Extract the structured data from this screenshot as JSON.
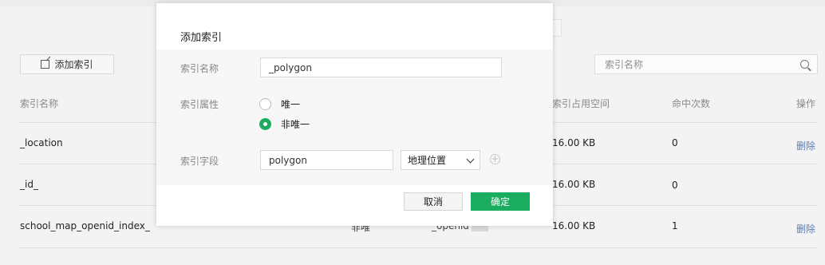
{
  "toolbar": {
    "add_index_label": "添加索引"
  },
  "search": {
    "placeholder": "索引名称"
  },
  "table": {
    "headers": {
      "name": "索引名称",
      "space": "索引占用空间",
      "hits": "命中次数",
      "action": "操作"
    },
    "rows": [
      {
        "name": "_location",
        "space": "16.00 KB",
        "hits": "0",
        "action": "删除"
      },
      {
        "name": "_id_",
        "space": "16.00 KB",
        "hits": "0",
        "action": ""
      },
      {
        "name": "school_map_openid_index_",
        "space": "16.00 KB",
        "hits": "1",
        "action": "删除",
        "partial_type": "非唯",
        "partial_field": "_openid"
      }
    ]
  },
  "modal": {
    "title": "添加索引",
    "name_label": "索引名称",
    "name_value": "_polygon",
    "attr_label": "索引属性",
    "radio_unique": "唯一",
    "radio_non_unique": "非唯一",
    "radio_selected": "非唯一",
    "field_label": "索引字段",
    "field_value": "polygon",
    "field_type": "地理位置",
    "cancel_label": "取消",
    "confirm_label": "确定"
  },
  "colors": {
    "accent": "#1aad5f",
    "link": "#5b7db8"
  },
  "icons": [
    "edit-icon",
    "search-icon",
    "chevron-down-icon",
    "plus-circle-icon"
  ]
}
